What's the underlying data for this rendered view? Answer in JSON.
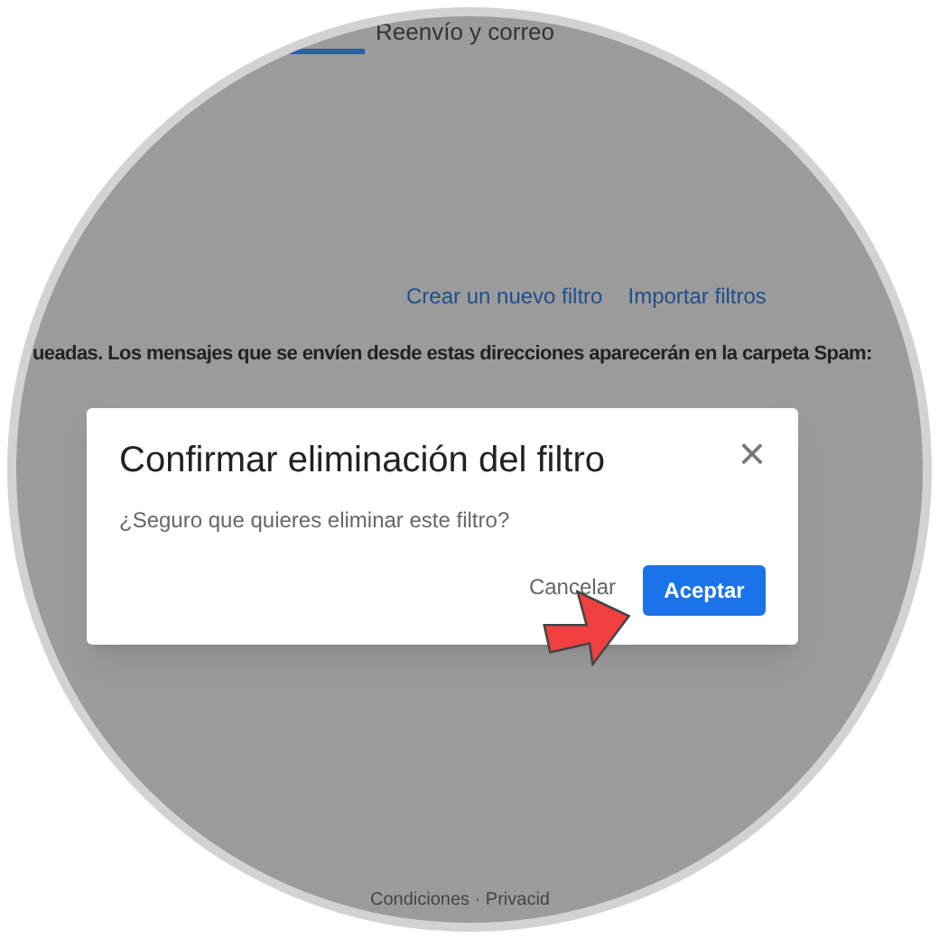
{
  "tab": {
    "label": "Reenvío y correo",
    "selected": false
  },
  "links": [
    "Crear un nuevo filtro",
    "Importar filtros"
  ],
  "notice": "ueadas. Los mensajes que se envíen desde estas direcciones aparecerán en la carpeta Spam:",
  "dialog": {
    "title": "Confirmar eliminación del filtro",
    "message": "¿Seguro que quieres eliminar este filtro?",
    "close": "×",
    "buttons": [
      {
        "label": "Cancelar",
        "kind": "text"
      },
      {
        "label": "Aceptar",
        "kind": "primary"
      }
    ]
  },
  "footer": "Condiciones · Privacid"
}
